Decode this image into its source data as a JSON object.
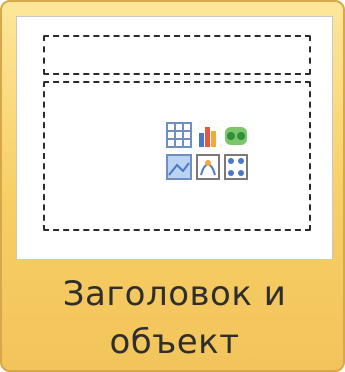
{
  "layout_tile": {
    "caption_line1": "Заголовок и",
    "caption_line2": "объект",
    "icons": [
      "table-icon",
      "chart-icon",
      "smartart-icon",
      "picture-icon",
      "clipart-icon",
      "media-icon"
    ],
    "colors": {
      "tile_highlight": "#f7ce64",
      "tile_border": "#d7a84a",
      "placeholder_border": "#2b2b2b",
      "slide_background": "#ffffff"
    }
  }
}
